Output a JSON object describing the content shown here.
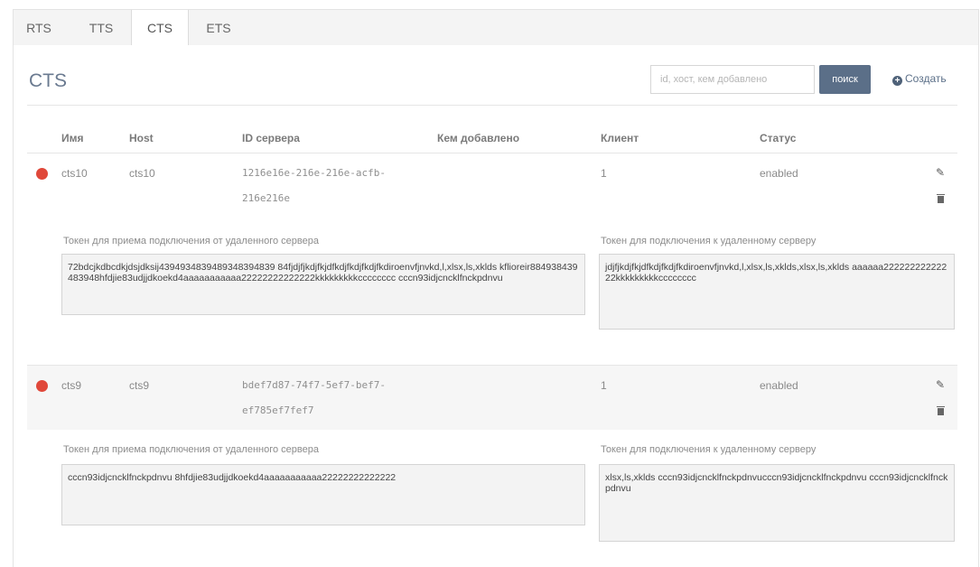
{
  "tabs": [
    {
      "label": "RTS"
    },
    {
      "label": "TTS"
    },
    {
      "label": "CTS"
    },
    {
      "label": "ETS"
    }
  ],
  "page": {
    "title": "CTS",
    "search_placeholder": "id, хост, кем добавлено",
    "search_button": "поиск",
    "create_label": "Создать"
  },
  "table": {
    "columns": [
      "Имя",
      "Host",
      "ID сервера",
      "Кем добавлено",
      "Клиент",
      "Статус"
    ],
    "rows": [
      {
        "name": "cts10",
        "host": "cts10",
        "id_line1": "1216e16e-216e-216e-acfb-",
        "id_line2": "216e216e",
        "added_by": "",
        "client": "1",
        "status": "enabled",
        "status_color": "#e0483a",
        "token_in_label": "Токен для приема подключения от удаленного сервера",
        "token_in": "72bdcjkdbcdkjdsjdksij4394934839489348394839 84fjdjfjkdjfkjdfkdjfkdjfkdjfkdiroenvfjnvkd,l,xlsx,ls,xklds kflioreir884938439483948hfdjie83udjjdkoekd4aaaaaaaaaaa22222222222222kkkkkkkkkcccccccc cccn93idjcncklfnckpdnvu",
        "token_out_label": "Токен для подключения к удаленному серверу",
        "token_out": "jdjfjkdjfkjdfkdjfkdjfkdiroenvfjnvkd,l,xlsx,ls,xklds,xlsx,ls,xklds aaaaaa22222222222222kkkkkkkkkcccccccc"
      },
      {
        "name": "cts9",
        "host": "cts9",
        "id_line1": "bdef7d87-74f7-5ef7-bef7-",
        "id_line2": "ef785ef7fef7",
        "added_by": "",
        "client": "1",
        "status": "enabled",
        "status_color": "#e0483a",
        "token_in_label": "Токен для приема подключения от удаленного сервера",
        "token_in": "cccn93idjcncklfnckpdnvu 8hfdjie83udjjdkoekd4aaaaaaaaaaa22222222222222",
        "token_out_label": "Токен для подключения к удаленному серверу",
        "token_out": "xlsx,ls,xklds cccn93idjcncklfnckpdnvucccn93idjcncklfnckpdnvu cccn93idjcncklfnckpdnvu"
      }
    ]
  },
  "icons": {
    "edit": "pencil-icon",
    "delete": "trash-icon",
    "create": "plus-circle-icon"
  }
}
